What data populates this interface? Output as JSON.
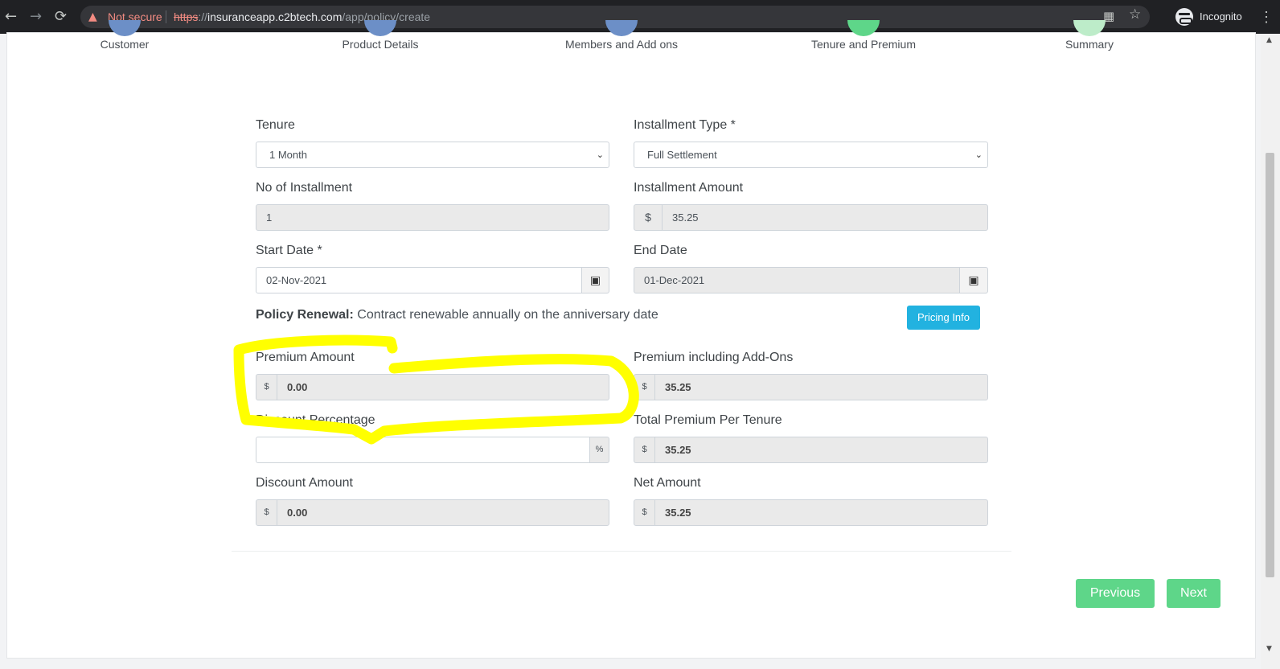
{
  "browser": {
    "back_icon": "←",
    "forward_icon": "→",
    "reload_icon": "⟳",
    "warning_icon": "▲",
    "not_secure": "Not secure",
    "url_scheme": "https",
    "url_sep": "://",
    "url_host": "insuranceapp.c2btech.com",
    "url_path": "/app/policy/create",
    "qr_icon": "▦",
    "star_icon": "☆",
    "incognito_label": "Incognito",
    "menu_icon": "⋮"
  },
  "steps": [
    {
      "label": "Customer",
      "color": "#6c8fc7"
    },
    {
      "label": "Product Details",
      "color": "#6c8fc7"
    },
    {
      "label": "Members and Add ons",
      "color": "#6c8fc7"
    },
    {
      "label": "Tenure and Premium",
      "color": "#5ed689"
    },
    {
      "label": "Summary",
      "color": "#bdecc9"
    }
  ],
  "form": {
    "tenure": {
      "label": "Tenure",
      "value": "1 Month"
    },
    "installment_type": {
      "label": "Installment Type *",
      "value": "Full Settlement"
    },
    "no_of_installment": {
      "label": "No of Installment",
      "value": "1"
    },
    "installment_amount": {
      "label": "Installment Amount",
      "prefix": "$",
      "value": "35.25"
    },
    "start_date": {
      "label": "Start Date *",
      "value": "02-Nov-2021"
    },
    "end_date": {
      "label": "End Date",
      "value": "01-Dec-2021"
    },
    "calendar_icon": "▣",
    "caret_icon": "⌄",
    "policy_renewal_label": "Policy Renewal:",
    "policy_renewal_text": "Contract renewable annually on the anniversary date",
    "pricing_info_button": "Pricing Info",
    "premium_amount": {
      "label": "Premium Amount",
      "prefix": "$",
      "value": "0.00"
    },
    "premium_including_addons": {
      "label": "Premium including Add-Ons",
      "prefix": "$",
      "value": "35.25"
    },
    "discount_percentage": {
      "label": "Discount Percentage",
      "suffix": "%",
      "value": ""
    },
    "total_premium_per_tenure": {
      "label": "Total Premium Per Tenure",
      "prefix": "$",
      "value": "35.25"
    },
    "discount_amount": {
      "label": "Discount Amount",
      "prefix": "$",
      "value": "0.00"
    },
    "net_amount": {
      "label": "Net Amount",
      "prefix": "$",
      "value": "35.25"
    }
  },
  "buttons": {
    "previous": "Previous",
    "next": "Next"
  },
  "scrollbar": {
    "up_icon": "▲",
    "down_icon": "▼"
  },
  "annotation": {
    "color": "#ffff00",
    "target": "Premium Amount"
  }
}
